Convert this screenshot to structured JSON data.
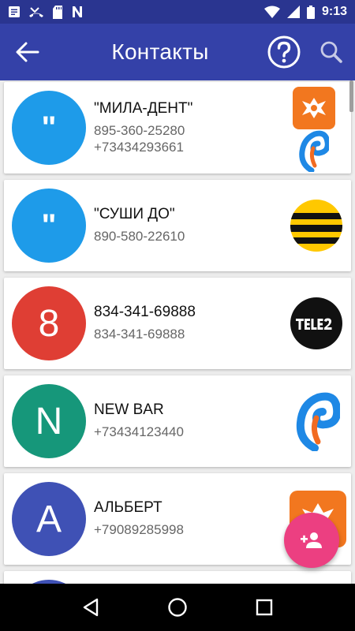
{
  "status_bar": {
    "time": "9:13",
    "left_icons": [
      "notes-icon",
      "missed-call-icon",
      "sd-card-icon",
      "n-app-icon"
    ],
    "right_icons": [
      "wifi-icon",
      "signal-icon",
      "battery-icon"
    ]
  },
  "app_bar": {
    "title": "Контакты",
    "background": "#3441a8",
    "status_background": "#2a3590"
  },
  "contacts": [
    {
      "avatar_letter": "\"",
      "avatar_color": "#1e9be9",
      "name": "\"МИЛА-ДЕНТ\"",
      "phones": [
        "895-360-25280",
        "+73434293661"
      ],
      "logos": [
        "megafon-logo",
        "rostelecom-logo"
      ]
    },
    {
      "avatar_letter": "\"",
      "avatar_color": "#1e9be9",
      "name": "\"СУШИ ДО\"",
      "phones": [
        "890-580-22610"
      ],
      "logos": [
        "beeline-logo"
      ]
    },
    {
      "avatar_letter": "8",
      "avatar_color": "#df3e34",
      "name": "834-341-69888",
      "phones": [
        "834-341-69888"
      ],
      "logos": [
        "tele2-logo"
      ]
    },
    {
      "avatar_letter": "N",
      "avatar_color": "#16977a",
      "name": "NEW BAR",
      "phones": [
        "+73434123440"
      ],
      "logos": [
        "rostelecom-logo"
      ]
    },
    {
      "avatar_letter": "A",
      "avatar_color": "#3f51b5",
      "name": "АЛЬБЕРТ",
      "phones": [
        "+79089285998"
      ],
      "logos": [
        "megafon-logo"
      ]
    }
  ],
  "fab": {
    "icon": "add-contact-icon",
    "color": "#ec3f81"
  },
  "nav_bar": {
    "icons": [
      "back-triangle-icon",
      "home-circle-icon",
      "recents-square-icon"
    ]
  }
}
